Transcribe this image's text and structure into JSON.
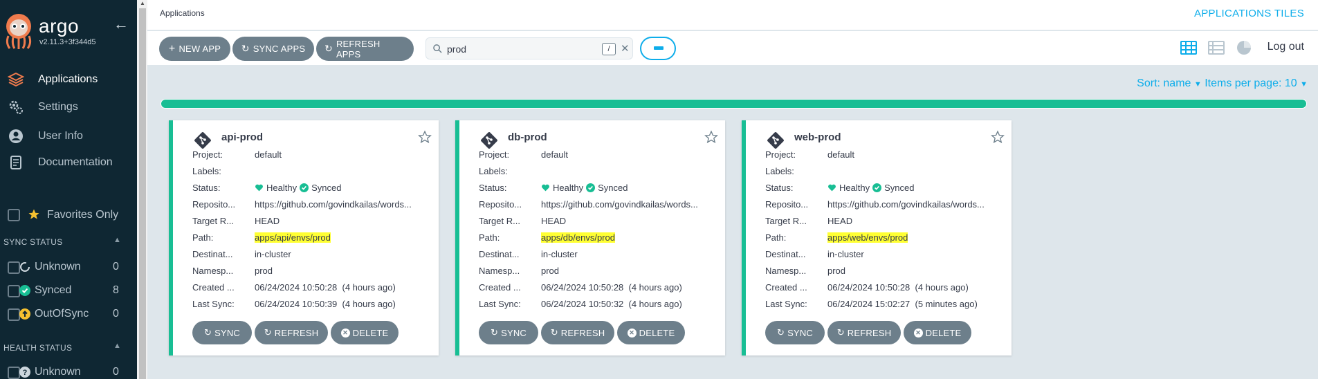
{
  "app": {
    "brand": "argo",
    "version": "v2.11.3+3f344d5"
  },
  "sidebar": {
    "nav": [
      {
        "label": "Applications",
        "icon": "layers-icon",
        "active": true
      },
      {
        "label": "Settings",
        "icon": "gears-icon",
        "active": false
      },
      {
        "label": "User Info",
        "icon": "user-circle-icon",
        "active": false
      },
      {
        "label": "Documentation",
        "icon": "book-icon",
        "active": false
      }
    ],
    "favorites_label": "Favorites Only",
    "sync_status": {
      "title": "SYNC STATUS",
      "items": [
        {
          "label": "Unknown",
          "count": "0",
          "icon": "circle-notch-icon"
        },
        {
          "label": "Synced",
          "count": "8",
          "icon": "check-circle-icon"
        },
        {
          "label": "OutOfSync",
          "count": "0",
          "icon": "arrow-up-circle-icon"
        }
      ]
    },
    "health_status": {
      "title": "HEALTH STATUS",
      "items": [
        {
          "label": "Unknown",
          "count": "0",
          "icon": "question-circle-icon"
        }
      ]
    }
  },
  "header": {
    "breadcrumb": "Applications",
    "title": "APPLICATIONS TILES"
  },
  "toolbar": {
    "new_app": "NEW APP",
    "sync_apps": "SYNC APPS",
    "refresh_apps": "REFRESH APPS",
    "search_value": "prod",
    "search_shortcut": "/",
    "logout": "Log out"
  },
  "sort": {
    "sort_label": "Sort: name",
    "per_page_label": "Items per page: 10"
  },
  "summary_progress": 1.0,
  "colors": {
    "accent": "#0dadea",
    "healthy": "#18be94",
    "sidebar_bg": "#0f2733",
    "button_bg": "#6d7f8b",
    "highlight": "#ffff33"
  },
  "labels": {
    "project": "Project:",
    "labels": "Labels:",
    "status": "Status:",
    "repository": "Reposito...",
    "target": "Target R...",
    "path": "Path:",
    "destination": "Destinat...",
    "namespace": "Namesp...",
    "created": "Created ...",
    "last_sync": "Last Sync:",
    "healthy": "Healthy",
    "synced": "Synced",
    "sync_btn": "SYNC",
    "refresh_btn": "REFRESH",
    "delete_btn": "DELETE"
  },
  "apps": [
    {
      "name": "api-prod",
      "project": "default",
      "labels": "",
      "repository": "https://github.com/govindkailas/words...",
      "target": "HEAD",
      "path": "apps/api/envs/prod",
      "destination": "in-cluster",
      "namespace": "prod",
      "created": "06/24/2024 10:50:28  (4 hours ago)",
      "last_sync": "06/24/2024 10:50:39  (4 hours ago)"
    },
    {
      "name": "db-prod",
      "project": "default",
      "labels": "",
      "repository": "https://github.com/govindkailas/words...",
      "target": "HEAD",
      "path": "apps/db/envs/prod",
      "destination": "in-cluster",
      "namespace": "prod",
      "created": "06/24/2024 10:50:28  (4 hours ago)",
      "last_sync": "06/24/2024 10:50:32  (4 hours ago)"
    },
    {
      "name": "web-prod",
      "project": "default",
      "labels": "",
      "repository": "https://github.com/govindkailas/words...",
      "target": "HEAD",
      "path": "apps/web/envs/prod",
      "destination": "in-cluster",
      "namespace": "prod",
      "created": "06/24/2024 10:50:28  (4 hours ago)",
      "last_sync": "06/24/2024 15:02:27  (5 minutes ago)"
    }
  ]
}
